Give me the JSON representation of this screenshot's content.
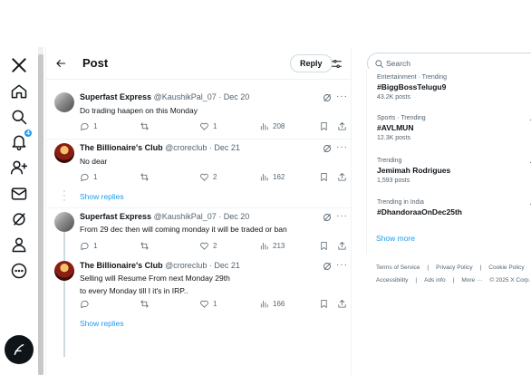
{
  "nav": {
    "notification_count": "4",
    "items": [
      "x-logo",
      "home",
      "explore",
      "notifications",
      "follow",
      "messages",
      "grok",
      "profile",
      "more"
    ]
  },
  "header": {
    "title": "Post",
    "reply_label": "Reply"
  },
  "tweets": [
    {
      "name": "Superfast Express",
      "handle": "@KaushikPal_07",
      "sep": "·",
      "date": "Dec 20",
      "text": "Do trading haapen on this Monday",
      "replies": "1",
      "retweets": "",
      "likes": "1",
      "views": "208"
    },
    {
      "name": "The Billionaire's Club",
      "handle": "@croreclub",
      "sep": "·",
      "date": "Dec 21",
      "text": "No dear",
      "replies": "1",
      "retweets": "",
      "likes": "2",
      "views": "162"
    },
    {
      "name": "Superfast Express",
      "handle": "@KaushikPal_07",
      "sep": "·",
      "date": "Dec 20",
      "text": "From 29 dec then will coming monday it will be traded or ban",
      "replies": "1",
      "retweets": "",
      "likes": "2",
      "views": "213"
    },
    {
      "name": "The Billionaire's Club",
      "handle": "@croreclub",
      "sep": "·",
      "date": "Dec 21",
      "text_line1": "Selling will Resume From next  Monday 29th",
      "text_line2": "to every Monday till I it's in IRP..",
      "replies": "",
      "retweets": "",
      "likes": "1",
      "views": "166"
    }
  ],
  "show_replies": "Show replies",
  "search": {
    "placeholder": "Search"
  },
  "trends": [
    {
      "category": "Entertainment · Trending",
      "name": "#BiggBossTelugu9",
      "posts": "43.2K posts"
    },
    {
      "category": "Sports · Trending",
      "name": "#AVLMUN",
      "posts": "12.3K posts"
    },
    {
      "category": "Trending",
      "name": "Jemimah Rodrigues",
      "posts": "1,593 posts"
    },
    {
      "category": "Trending in India",
      "name": "#DhandoraaOnDec25th",
      "posts": ""
    }
  ],
  "show_more": "Show more",
  "footer": {
    "links": [
      "Terms of Service",
      "|",
      "Privacy Policy",
      "|",
      "Cookie Policy",
      "|",
      "Accessibility",
      "|",
      "Ads info",
      "|",
      "More ···",
      "© 2025 X Corp."
    ]
  },
  "colors": {
    "accent": "#1d9bf0",
    "text": "#0f1419",
    "muted": "#536471",
    "border": "#eff3f4"
  }
}
